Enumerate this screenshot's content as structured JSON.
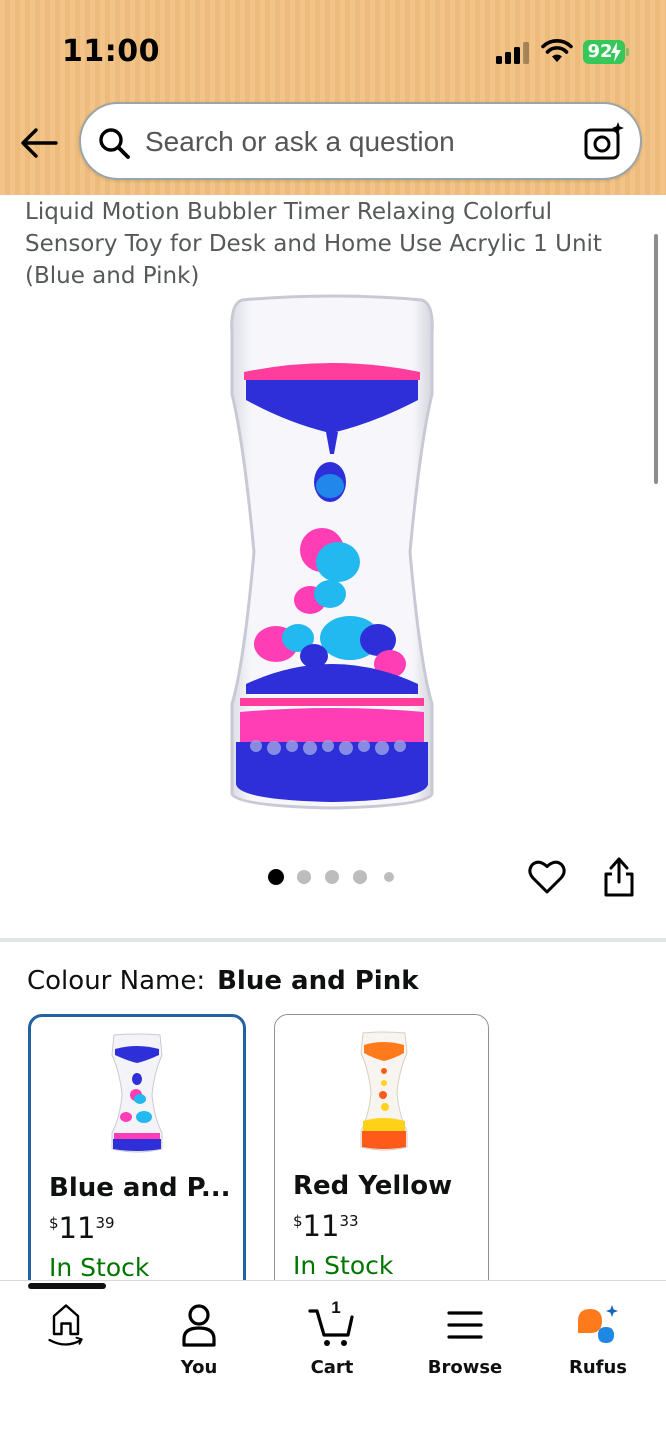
{
  "status_bar": {
    "time": "11:00",
    "battery": "92"
  },
  "search": {
    "placeholder": "Search or ask a question"
  },
  "product": {
    "title": "Liquid Motion Bubbler Timer Relaxing Colorful Sensory Toy for Desk and Home Use Acrylic 1 Unit (Blue and Pink)",
    "image_pages": 5,
    "active_page": 1
  },
  "colour": {
    "label": "Colour Name:",
    "selected_value": "Blue and Pink",
    "options": [
      {
        "name": "Blue and P...",
        "currency": "$",
        "whole": "11",
        "fraction": "39",
        "stock": "In Stock"
      },
      {
        "name": "Red Yellow",
        "currency": "$",
        "whole": "11",
        "fraction": "33",
        "stock": "In Stock"
      }
    ]
  },
  "nav": {
    "items": [
      {
        "label": "",
        "icon": "home-icon"
      },
      {
        "label": "You",
        "icon": "user-icon"
      },
      {
        "label": "Cart",
        "icon": "cart-icon",
        "count": "1"
      },
      {
        "label": "Browse",
        "icon": "menu-icon"
      },
      {
        "label": "Rufus",
        "icon": "rufus-icon"
      }
    ]
  },
  "colors": {
    "header_bg": "#f2c489",
    "selected_border": "#2162a1",
    "stock_green": "#007600",
    "rufus_orange": "#ff7a1a",
    "rufus_blue": "#1e88e5"
  }
}
